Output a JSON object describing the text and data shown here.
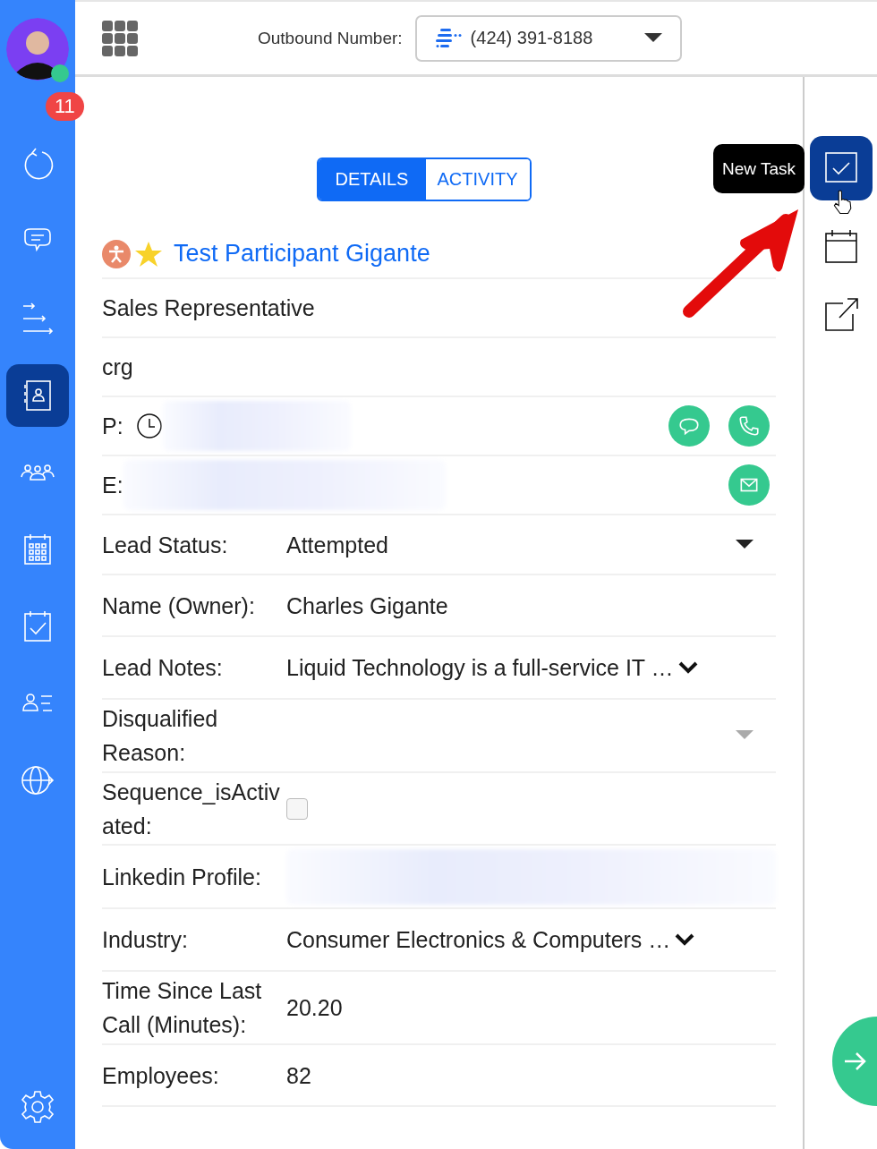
{
  "header": {
    "outbound_label": "Outbound Number:",
    "outbound_number": "(424) 391-8188"
  },
  "sidebar": {
    "items": [
      {
        "kind": "refresh",
        "selected": false,
        "badge": "11"
      },
      {
        "kind": "chat",
        "selected": false
      },
      {
        "kind": "sequence",
        "selected": false
      },
      {
        "kind": "contacts",
        "selected": true
      },
      {
        "kind": "team",
        "selected": false
      },
      {
        "kind": "calendar",
        "selected": false
      },
      {
        "kind": "tasks",
        "selected": false
      },
      {
        "kind": "list",
        "selected": false
      },
      {
        "kind": "globe",
        "selected": false
      }
    ]
  },
  "tabs": [
    {
      "label": "DETAILS",
      "selected": true
    },
    {
      "label": "ACTIVITY",
      "selected": false
    }
  ],
  "contact": {
    "name": "Test Participant Gigante",
    "starred": true
  },
  "fields": [
    {
      "kind": "line",
      "value": "Sales Representative"
    },
    {
      "kind": "line",
      "value": "crg"
    },
    {
      "kind": "phone",
      "label": "P:"
    },
    {
      "kind": "email",
      "label": "E:"
    },
    {
      "kind": "select",
      "label": "Lead Status:",
      "value": "Attempted"
    },
    {
      "kind": "text",
      "label": "Name (Owner):",
      "value": "Charles Gigante"
    },
    {
      "kind": "expand",
      "label": "Lead Notes:",
      "value": "Liquid Technology is a full-service IT …"
    },
    {
      "kind": "select",
      "label": "Disqualified Reason:"
    },
    {
      "kind": "checkbox",
      "label": "Sequence_isActivated:",
      "checked": false
    },
    {
      "kind": "redacted",
      "label": "Linkedin Profile:"
    },
    {
      "kind": "expand",
      "label": "Industry:",
      "value": "Consumer Electronics & Computers …"
    },
    {
      "kind": "text",
      "label": "Time Since Last Call (Minutes):",
      "value": "20.20"
    },
    {
      "kind": "text",
      "label": "Employees:",
      "value": "82"
    }
  ],
  "rail": {
    "tooltip": "New Task",
    "items": [
      {
        "kind": "task",
        "selected": true
      },
      {
        "kind": "calendar",
        "selected": false
      },
      {
        "kind": "external",
        "selected": false
      }
    ]
  }
}
